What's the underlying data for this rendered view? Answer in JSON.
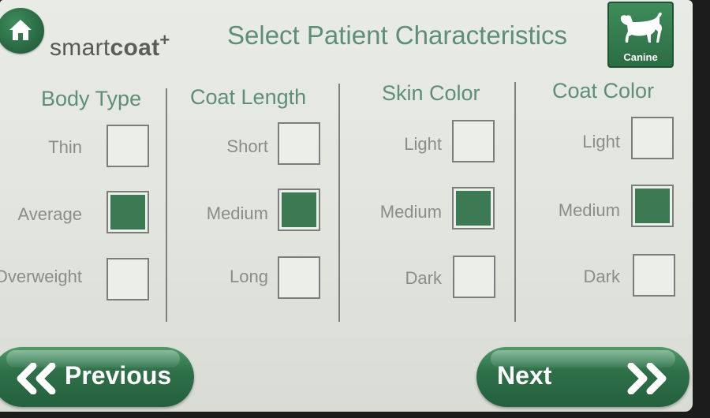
{
  "header": {
    "brand_prefix": "smart",
    "brand_bold": "coat",
    "brand_sup": "+",
    "title": "Select Patient Characteristics",
    "home_icon": "home-icon",
    "species_label": "Canine",
    "species_icon": "dog-icon"
  },
  "colors": {
    "accent_green": "#3b7a53",
    "title_green": "#5e8f74",
    "button_green": "#2f7049"
  },
  "columns": [
    {
      "header": "Body Type",
      "options": [
        {
          "label": "Thin",
          "checked": false
        },
        {
          "label": "Average",
          "checked": true
        },
        {
          "label": "Overweight",
          "checked": false
        }
      ]
    },
    {
      "header": "Coat Length",
      "options": [
        {
          "label": "Short",
          "checked": false
        },
        {
          "label": "Medium",
          "checked": true
        },
        {
          "label": "Long",
          "checked": false
        }
      ]
    },
    {
      "header": "Skin Color",
      "options": [
        {
          "label": "Light",
          "checked": false
        },
        {
          "label": "Medium",
          "checked": true
        },
        {
          "label": "Dark",
          "checked": false
        }
      ]
    },
    {
      "header": "Coat Color",
      "options": [
        {
          "label": "Light",
          "checked": false
        },
        {
          "label": "Medium",
          "checked": true
        },
        {
          "label": "Dark",
          "checked": false
        }
      ]
    }
  ],
  "footer": {
    "previous_label": "Previous",
    "next_label": "Next",
    "previous_icon": "double-chevron-left-icon",
    "next_icon": "double-chevron-right-icon"
  }
}
